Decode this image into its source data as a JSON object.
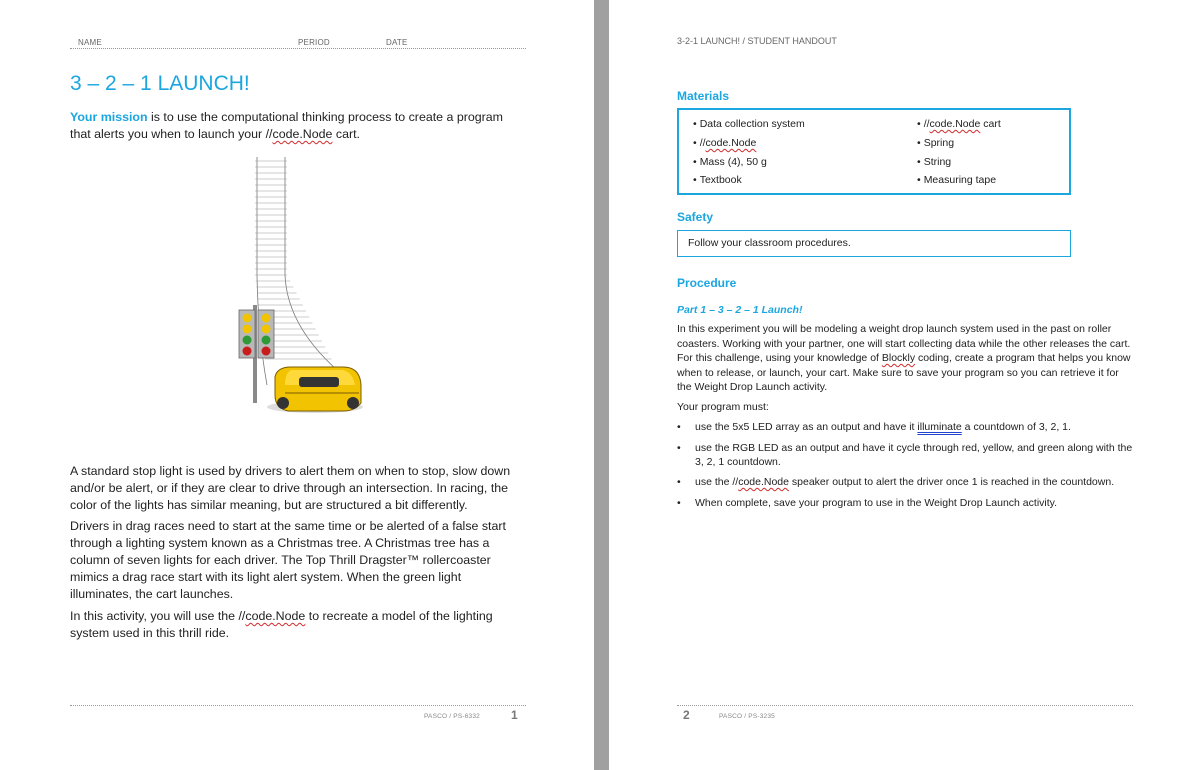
{
  "page1": {
    "header": {
      "name_label": "NAME",
      "period_label": "PERIOD",
      "date_label": "DATE"
    },
    "title": "3 – 2 – 1 LAUNCH!",
    "mission_highlight": "Your mission",
    "mission_text_1": " is to use the computational thinking process to create a program that alerts you when to launch your //",
    "mission_code": "code.Node",
    "mission_text_2": " cart.",
    "para1": "A standard stop light is used by drivers to alert them on when to stop, slow down and/or be alert, or if they are clear to drive through an intersection. In racing, the color of the lights has similar meaning, but are structured a bit differently.",
    "para2": "Drivers in drag races need to start at the same time or be alerted of a false start through a lighting system known as a Christmas tree. A Christmas tree has a column of seven lights for each driver. The Top Thrill Dragster™ rollercoaster mimics a drag race start with its light alert system. When the green light illuminates, the cart launches.",
    "para3_a": "In this activity, you will use the //",
    "para3_code": "code.Node",
    "para3_b": " to recreate a model of the lighting system used in this thrill ride.",
    "footer": {
      "text": "PASCO / PS-6332",
      "page_number": "1"
    }
  },
  "page2": {
    "header": "3-2-1 LAUNCH!  / STUDENT HANDOUT",
    "materials_title": "Materials",
    "materials_left": [
      "Data collection system",
      "//code.Node",
      "Mass (4), 50 g",
      "Textbook"
    ],
    "materials_right": [
      "//code.Node cart",
      "Spring",
      "String",
      "Measuring tape"
    ],
    "safety_title": "Safety",
    "safety_text": "Follow your classroom procedures.",
    "procedure_title": "Procedure",
    "part_title": "Part 1 – 3 – 2 – 1 Launch!",
    "proc_para_a": "In this experiment you will be modeling a weight drop launch system used in the past on roller coasters. Working with your partner, one will start collecting data while the other releases the cart. For this challenge, using your knowledge of ",
    "proc_para_code": "Blockly",
    "proc_para_b": " coding, create a program that helps you know when to release, or launch, your cart. Make sure to save your program so you can retrieve it for the Weight Drop Launch activity.",
    "program_must": "Your program must:",
    "bullet1_a": "use the 5x5 LED array as an output and have it ",
    "bullet1_link": "illuminate",
    "bullet1_b": " a countdown of 3, 2, 1.",
    "bullet2": "use the RGB LED as an output and have it cycle through red, yellow, and green along with the 3, 2, 1 countdown.",
    "bullet3_a": "use the //",
    "bullet3_code": "code.Node",
    "bullet3_b": " speaker output to alert the driver once 1 is reached in the countdown.",
    "bullet4": "When complete, save your program to use in the Weight Drop Launch activity.",
    "footer": {
      "page_number": "2",
      "text": "PASCO / PS-3235"
    }
  },
  "colors": {
    "accent": "#1ba6e0",
    "gutter": "#a0a0a0"
  }
}
